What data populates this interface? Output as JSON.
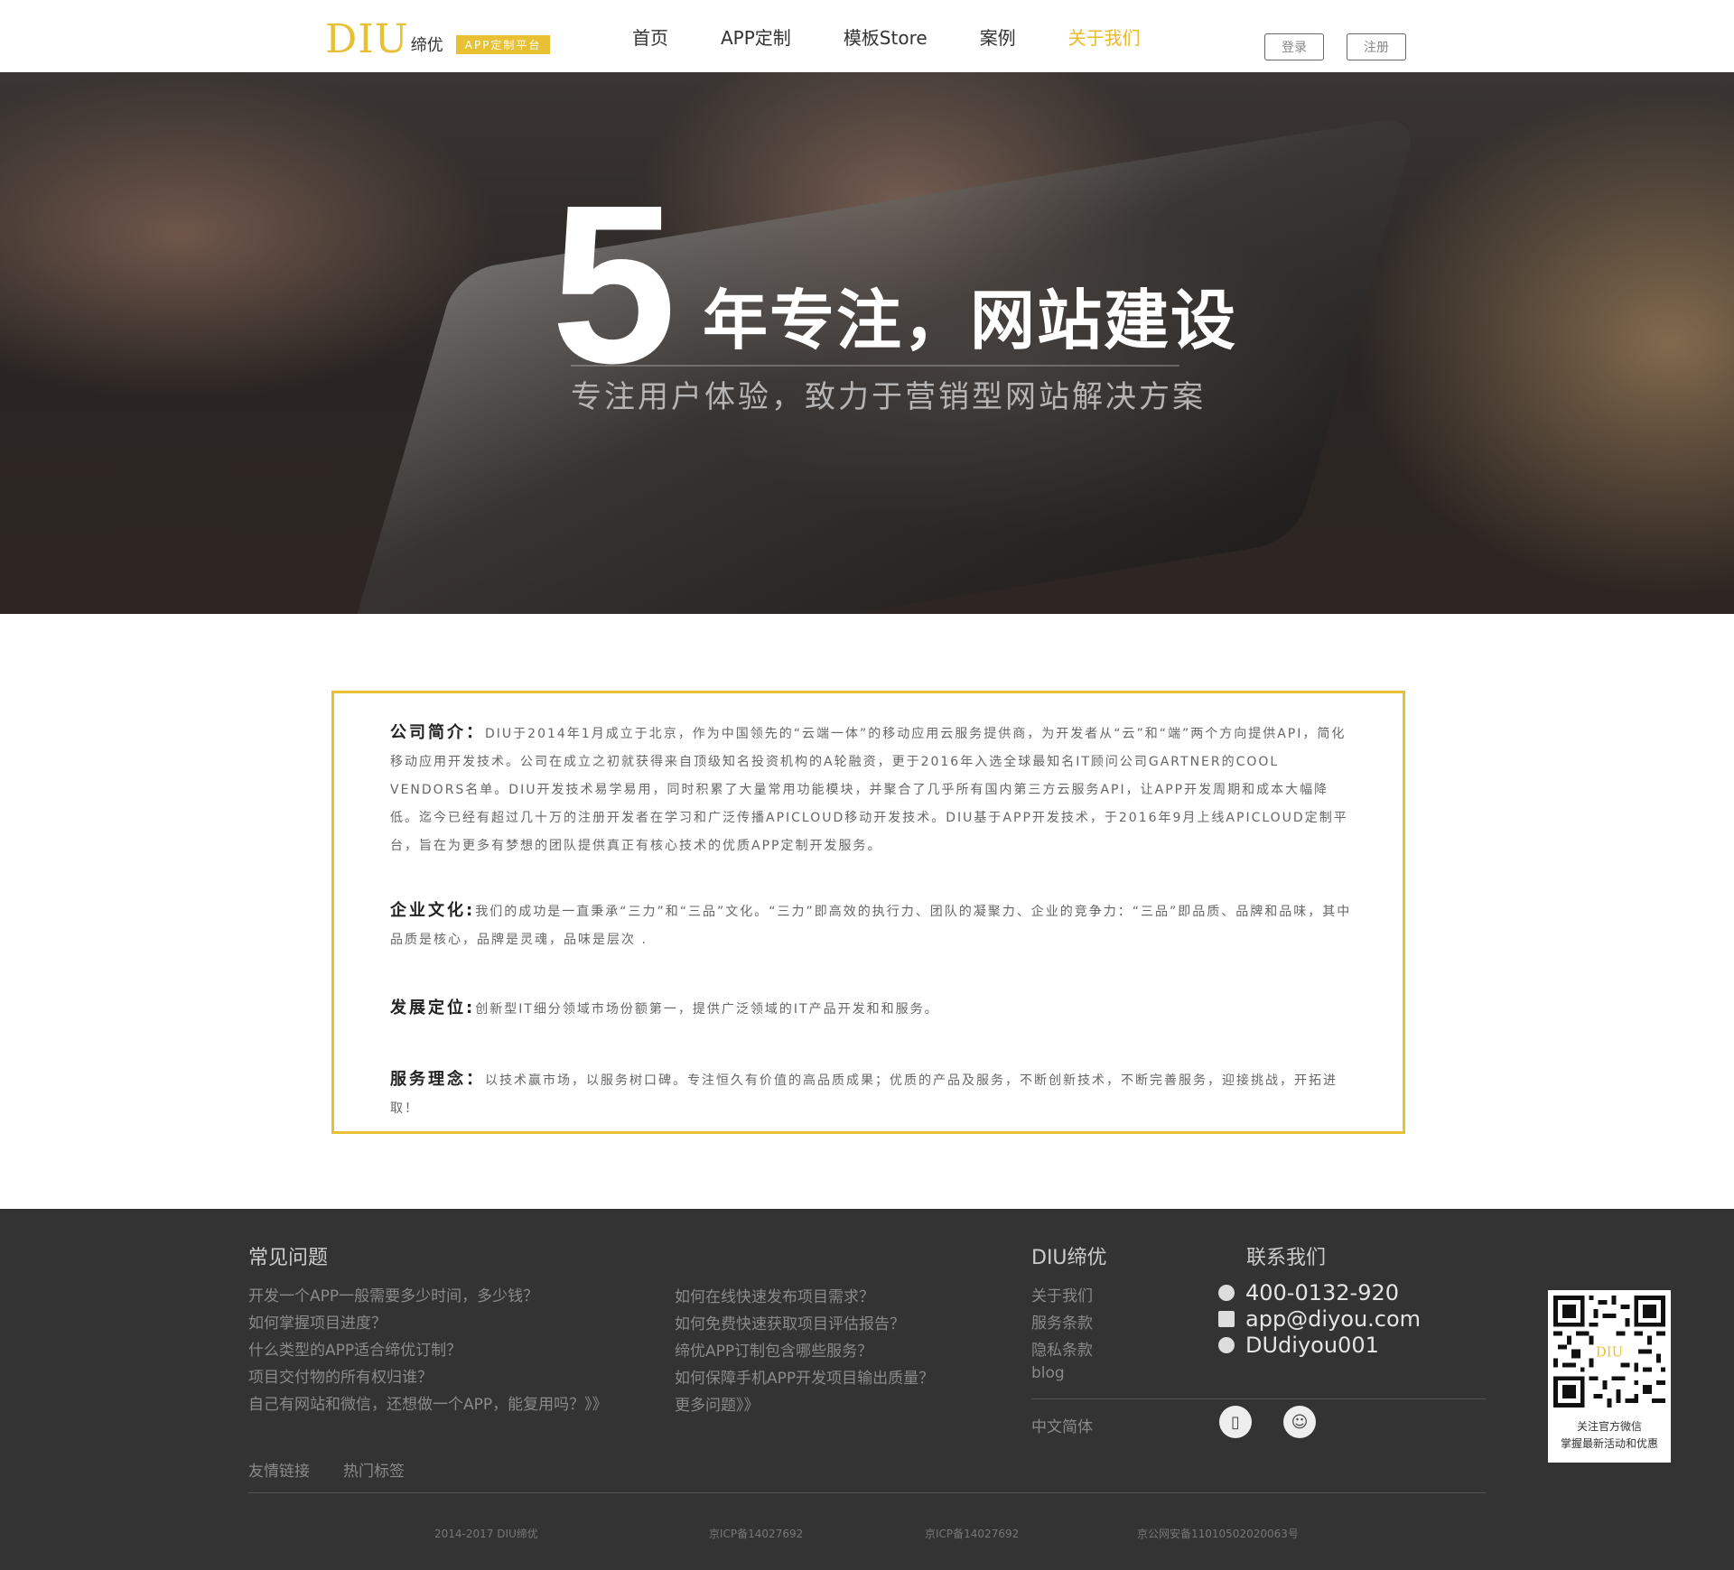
{
  "header": {
    "logo_mark": "DIU",
    "logo_cn": "缔优",
    "logo_badge": "APP定制平台",
    "nav": [
      "首页",
      "APP定制",
      "模板Store",
      "案例",
      "关于我们"
    ],
    "active_nav": "关于我们",
    "login": "登录",
    "register": "注册",
    "accent_color": "#e8c033"
  },
  "hero": {
    "big_number": "5",
    "title": "年专注，网站建设",
    "subtitle": "专注用户体验，致力于营销型网站解决方案"
  },
  "about": {
    "intro_label": "公司简介",
    "intro_sep": "：",
    "intro_text": "DIU于2014年1月成立于北京，作为中国领先的“云端一体”的移动应用云服务提供商，为开发者从“云”和“端”两个方向提供API，简化移动应用开发技术。公司在成立之初就获得来自顶级知名投资机构的A轮融资，更于2016年入选全球最知名IT顾问公司GARTNER的COOL VENDORS名单。DIU开发技术易学易用，同时积累了大量常用功能模块，并聚合了几乎所有国内第三方云服务API，让APP开发周期和成本大幅降低。迄今已经有超过几十万的注册开发者在学习和广泛传播APICLOUD移动开发技术。DIU基于APP开发技术，于2016年9月上线APICLOUD定制平台，旨在为更多有梦想的团队提供真正有核心技术的优质APP定制开发服务。",
    "culture_label": "企业文化",
    "culture_sep": ":",
    "culture_text": "我们的成功是一直秉承“三力”和“三品”文化。“三力”即高效的执行力、团队的凝聚力、企业的竞争力：“三品”即品质、品牌和品味，其中品质是核心，品牌是灵魂，品味是层次   .",
    "position_label": "发展定位",
    "position_sep": ":",
    "position_text": "创新型IT细分领域市场份额第一，提供广泛领域的IT产品开发和和服务。",
    "service_label": "服务理念",
    "service_sep": "：",
    "service_text": "以技术赢市场，以服务树口碑。专注恒久有价值的高品质成果；优质的产品及服务，不断创新技术，不断完善服务，迎接挑战，开拓进取！"
  },
  "footer": {
    "faq_title": "常见问题",
    "faq_left": [
      "开发一个APP一般需要多少时间，多少钱？",
      "如何掌握项目进度？",
      "什么类型的APP适合缔优订制？",
      "项目交付物的所有权归谁？",
      "自己有网站和微信，还想做一个APP，能复用吗？》》"
    ],
    "faq_right": [
      "如何在线快速发布项目需求？",
      "如何免费快速获取项目评估报告？",
      "缔优APP订制包含哪些服务？",
      "如何保障手机APP开发项目输出质量？",
      "更多问题》》"
    ],
    "brand_title": "DIU缔优",
    "brand_links": [
      "关于我们",
      "服务条款",
      "隐私条款",
      "blog"
    ],
    "language": "中文简体",
    "contact_title": "联系我们",
    "phone": "400-0132-920",
    "email": "app@diyou.com",
    "wechat_id": "DUdiyou001",
    "friend_links": "友情链接",
    "hot_tags": "热门标签",
    "qr_logo": "DIU",
    "qr_line1": "关注官方微信",
    "qr_line2": "掌握最新活动和优惠",
    "copyright": "2014-2017   DIU缔优",
    "icp1": "京ICP备14027692",
    "icp2": "京ICP备14027692",
    "police": "京公网安备11010502020063号"
  }
}
